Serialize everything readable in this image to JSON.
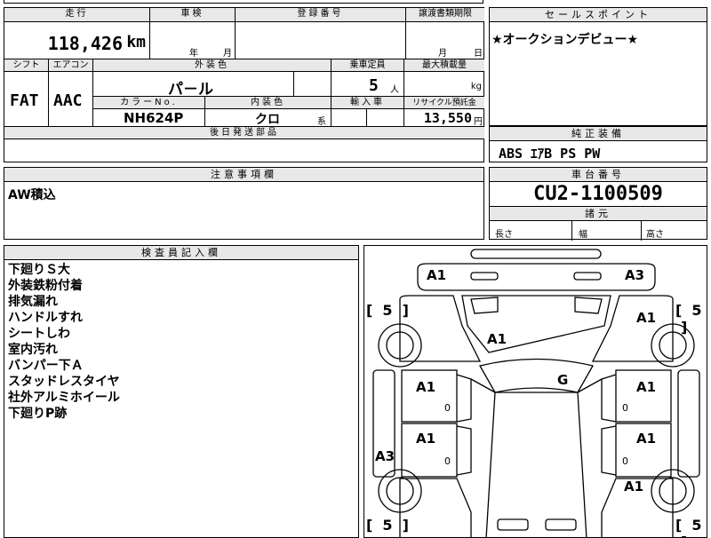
{
  "mileage": {
    "label": "走行",
    "value": "118,426",
    "unit": "km"
  },
  "inspection": {
    "label": "車検",
    "year_unit": "年",
    "month_unit": "月"
  },
  "registration": {
    "label": "登録番号"
  },
  "transfer_doc": {
    "label": "譲渡書類期限",
    "month_unit": "月",
    "day_unit": "日"
  },
  "selling_point": {
    "label": "セールスポイント",
    "text": "★オークションデビュー★"
  },
  "shift": {
    "label": "シフト",
    "value": "FAT"
  },
  "aircon": {
    "label": "エアコン",
    "value": "AAC"
  },
  "exterior_color": {
    "label": "外装色",
    "value": "パ－ル"
  },
  "capacity": {
    "label": "乗車定員",
    "value": "5",
    "unit": "人"
  },
  "max_load": {
    "label": "最大積載量",
    "unit": "kg"
  },
  "color_no": {
    "label": "カラーNo.",
    "value": "NH624P"
  },
  "interior_color": {
    "label": "内装色",
    "value": "クロ",
    "unit": "系"
  },
  "import": {
    "label": "輸入車"
  },
  "recycle": {
    "label": "リサイクル預託金",
    "value": "13,550",
    "unit": "円"
  },
  "later_parts": {
    "label": "後日発送部品"
  },
  "factory_equipment": {
    "label": "純正装備",
    "value": "ABS ｴｱB PS PW"
  },
  "notes": {
    "label": "注意事項欄",
    "text": "AW積込"
  },
  "chassis": {
    "label": "車台番号",
    "value": "CU2-1100509"
  },
  "dimensions": {
    "label": "諸元",
    "length": "長さ",
    "width": "幅",
    "height": "高さ"
  },
  "inspector": {
    "label": "検査員記入欄",
    "items": [
      "下廻りＳ大",
      "外装鉄粉付着",
      "排気漏れ",
      "ハンドルすれ",
      "シートしわ",
      "室内汚れ",
      "バンパー下Ａ",
      "スタッドレスタイヤ",
      "社外アルミホイール",
      "下廻りP跡"
    ]
  },
  "diagram": {
    "front_left": "A1",
    "front_right": "A3",
    "tire_fl": "5",
    "tire_fr": "5",
    "tire_rl": "5",
    "tire_rr": "5",
    "bracket_open": "[",
    "bracket_close": "]",
    "fender_r": "A1",
    "hood": "A1",
    "windshield": "G",
    "door_fl": "A1",
    "door_fr": "A1",
    "door_rl": "A1",
    "door_rr": "A1",
    "side_l": "A3",
    "quarter_r": "A1",
    "zero_fl": "0",
    "zero_fr": "0",
    "zero_rl": "0",
    "zero_rr": "0"
  }
}
